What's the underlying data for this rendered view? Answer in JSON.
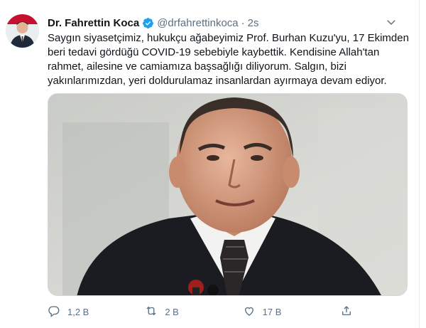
{
  "tweet": {
    "author_name": "Dr. Fahrettin Koca",
    "handle": "@drfahrettinkoca",
    "separator": "·",
    "time": "2s",
    "text_lines": [
      "Saygın siyasetçimiz, hukukçu ağabeyimiz Prof. Burhan Kuzu'yu, 17 Ekimden",
      "beri tedavi gördüğü COVID-19 sebebiyle kaybettik. Kendisine Allah'tan",
      "rahmet, ailesine ve camiamıza başsağlığı diliyorum. Salgın, bizi",
      "yakınlarımızdan, yeri doldurulamaz insanlardan ayırmaya devam ediyor."
    ]
  },
  "actions": {
    "reply_count": "1,2 B",
    "retweet_count": "2 B",
    "like_count": "17 B"
  },
  "icons": {
    "verified": "verified-badge-icon",
    "caret": "chevron-down-icon",
    "reply": "reply-icon",
    "retweet": "retweet-icon",
    "like": "heart-icon",
    "share": "share-icon"
  },
  "colors": {
    "verified_blue": "#1da1f2",
    "muted_text": "#5b7083",
    "main_text": "#0f1419"
  }
}
